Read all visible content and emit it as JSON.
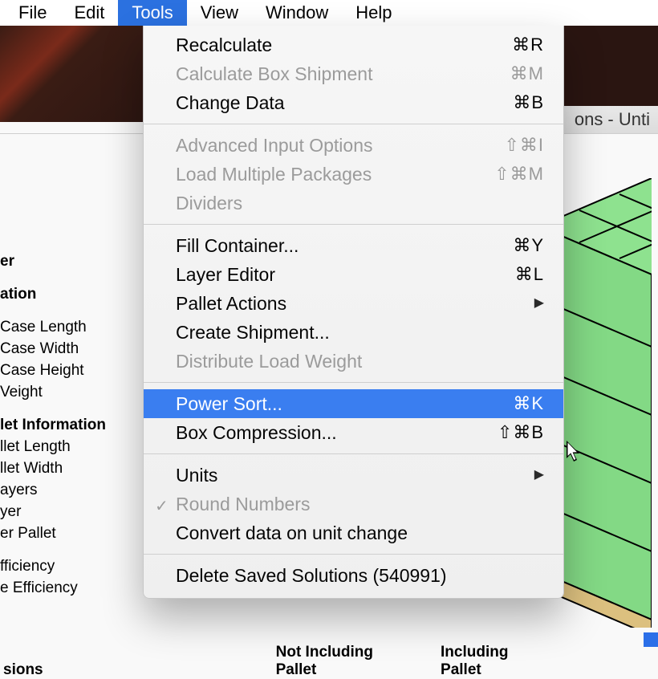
{
  "menubar": {
    "items": [
      "File",
      "Edit",
      "Tools",
      "View",
      "Window",
      "Help"
    ],
    "open_index": 2
  },
  "title_tail": "ons - Unti",
  "left_labels": {
    "sec1": "er",
    "sec2": "ation",
    "case_len": "Case Length",
    "case_wid": "Case Width",
    "case_hei": "Case Height",
    "weight": "Veight",
    "pallet_info": "let Information",
    "pl_len": "llet Length",
    "pl_wid": "llet Width",
    "layers": "ayers",
    "layer": "yer",
    "per_pal": "er Pallet",
    "eff1": "fficiency",
    "eff2": "e Efficiency"
  },
  "menu": {
    "items": [
      {
        "label": "Recalculate",
        "shortcut": "⌘R"
      },
      {
        "label": "Calculate Box Shipment",
        "shortcut": "⌘M",
        "disabled": true
      },
      {
        "label": "Change Data",
        "shortcut": "⌘B"
      },
      {
        "sep": true
      },
      {
        "label": "Advanced Input Options",
        "shortcut": "⇧⌘I",
        "disabled": true
      },
      {
        "label": "Load Multiple Packages",
        "shortcut": "⇧⌘M",
        "disabled": true
      },
      {
        "label": "Dividers",
        "disabled": true
      },
      {
        "sep": true
      },
      {
        "label": "Fill Container...",
        "shortcut": "⌘Y"
      },
      {
        "label": "Layer Editor",
        "shortcut": "⌘L"
      },
      {
        "label": "Pallet Actions",
        "submenu": true
      },
      {
        "label": "Create Shipment..."
      },
      {
        "label": "Distribute Load Weight",
        "disabled": true
      },
      {
        "sep": true
      },
      {
        "label": "Power Sort...",
        "shortcut": "⌘K",
        "highlight": true
      },
      {
        "label": "Box Compression...",
        "shortcut": "⇧⌘B"
      },
      {
        "sep": true
      },
      {
        "label": "Units",
        "submenu": true
      },
      {
        "label": "Round Numbers",
        "disabled": true,
        "checked": true
      },
      {
        "label": "Convert data on unit change"
      },
      {
        "sep": true
      },
      {
        "label": "Delete Saved Solutions (540991)"
      }
    ]
  },
  "bottom": {
    "left": "sions",
    "mid": "Not Including Pallet",
    "right": "Including Pallet"
  }
}
